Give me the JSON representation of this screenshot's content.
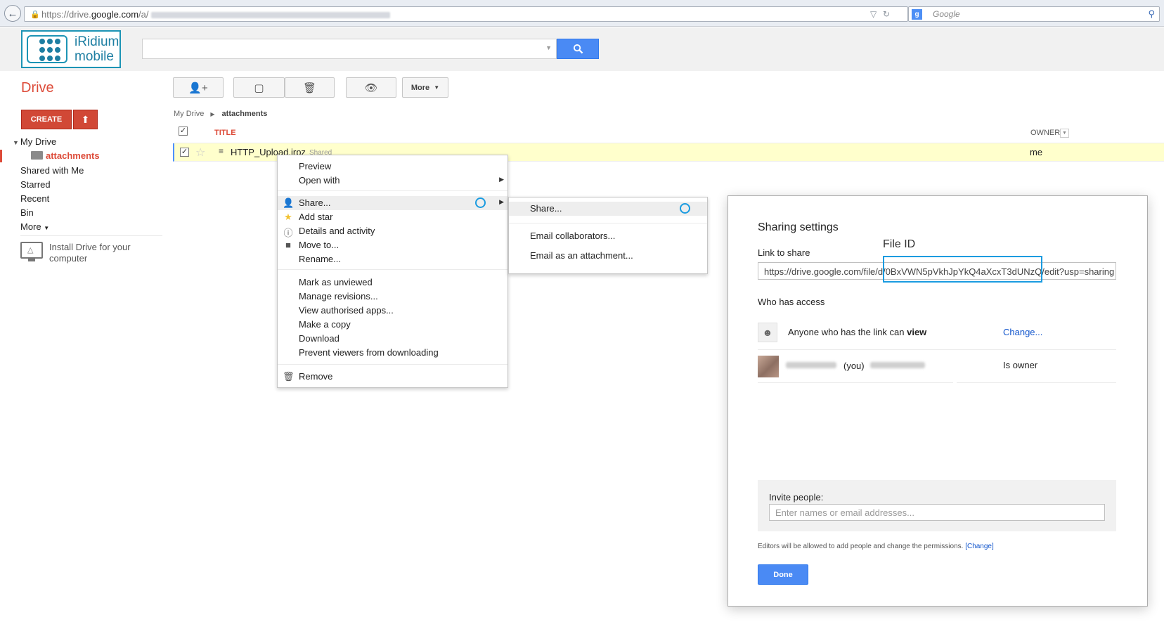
{
  "browser": {
    "back_icon": "back-arrow-icon",
    "url_prefix": "https://drive.",
    "url_domain": "google.com",
    "url_path": "/a/",
    "search_engine": "Google"
  },
  "header": {
    "logo_line1": "iRidium",
    "logo_line2": "mobile",
    "search_placeholder": ""
  },
  "sidebar": {
    "title": "Drive",
    "create_label": "CREATE",
    "my_drive": "My Drive",
    "attachments": "attachments",
    "items": [
      {
        "label": "Shared with Me"
      },
      {
        "label": "Starred"
      },
      {
        "label": "Recent"
      },
      {
        "label": "Bin"
      },
      {
        "label": "More"
      }
    ],
    "install_text": "Install Drive for your computer"
  },
  "toolbar": {
    "more_label": "More"
  },
  "breadcrumb": {
    "root": "My Drive",
    "current": "attachments"
  },
  "file_list": {
    "col_title": "TITLE",
    "col_owner": "OWNER",
    "rows": [
      {
        "name": "HTTP_Upload.irpz",
        "badge": "Shared",
        "owner": "me"
      }
    ]
  },
  "context_menu": {
    "group1": [
      {
        "label": "Preview"
      },
      {
        "label": "Open with"
      }
    ],
    "group2": [
      {
        "label": "Share..."
      },
      {
        "label": "Add star"
      },
      {
        "label": "Details and activity"
      },
      {
        "label": "Move to..."
      },
      {
        "label": "Rename..."
      }
    ],
    "group3": [
      {
        "label": "Mark as unviewed"
      },
      {
        "label": "Manage revisions..."
      },
      {
        "label": "View authorised apps..."
      },
      {
        "label": "Make a copy"
      },
      {
        "label": "Download"
      },
      {
        "label": "Prevent viewers from downloading"
      }
    ],
    "group4": [
      {
        "label": "Remove"
      }
    ]
  },
  "share_submenu": {
    "items": [
      {
        "label": "Share..."
      },
      {
        "label": "Email collaborators..."
      },
      {
        "label": "Email as an attachment..."
      }
    ]
  },
  "sharing_dialog": {
    "title": "Sharing settings",
    "link_label": "Link to share",
    "link_value": "https://drive.google.com/file/d/0BxVWN5pVkhJpYkQ4aXcxT3dUNzQ/edit?usp=sharing",
    "file_id_label": "File ID",
    "access_label": "Who has access",
    "access_rows": [
      {
        "text_prefix": "Anyone who has the link can ",
        "text_bold": "view",
        "action": "Change..."
      },
      {
        "you_label": "(you)",
        "role": "Is owner"
      }
    ],
    "invite_label": "Invite people:",
    "invite_placeholder": "Enter names or email addresses...",
    "editors_note": "Editors will be allowed to add people and change the permissions.",
    "editors_change": "[Change]",
    "done_label": "Done"
  },
  "colors": {
    "accent_red": "#dd4b39",
    "accent_blue": "#4a8af4",
    "highlight_row": "#ffffcc",
    "annotation_blue": "#1a9be0"
  }
}
